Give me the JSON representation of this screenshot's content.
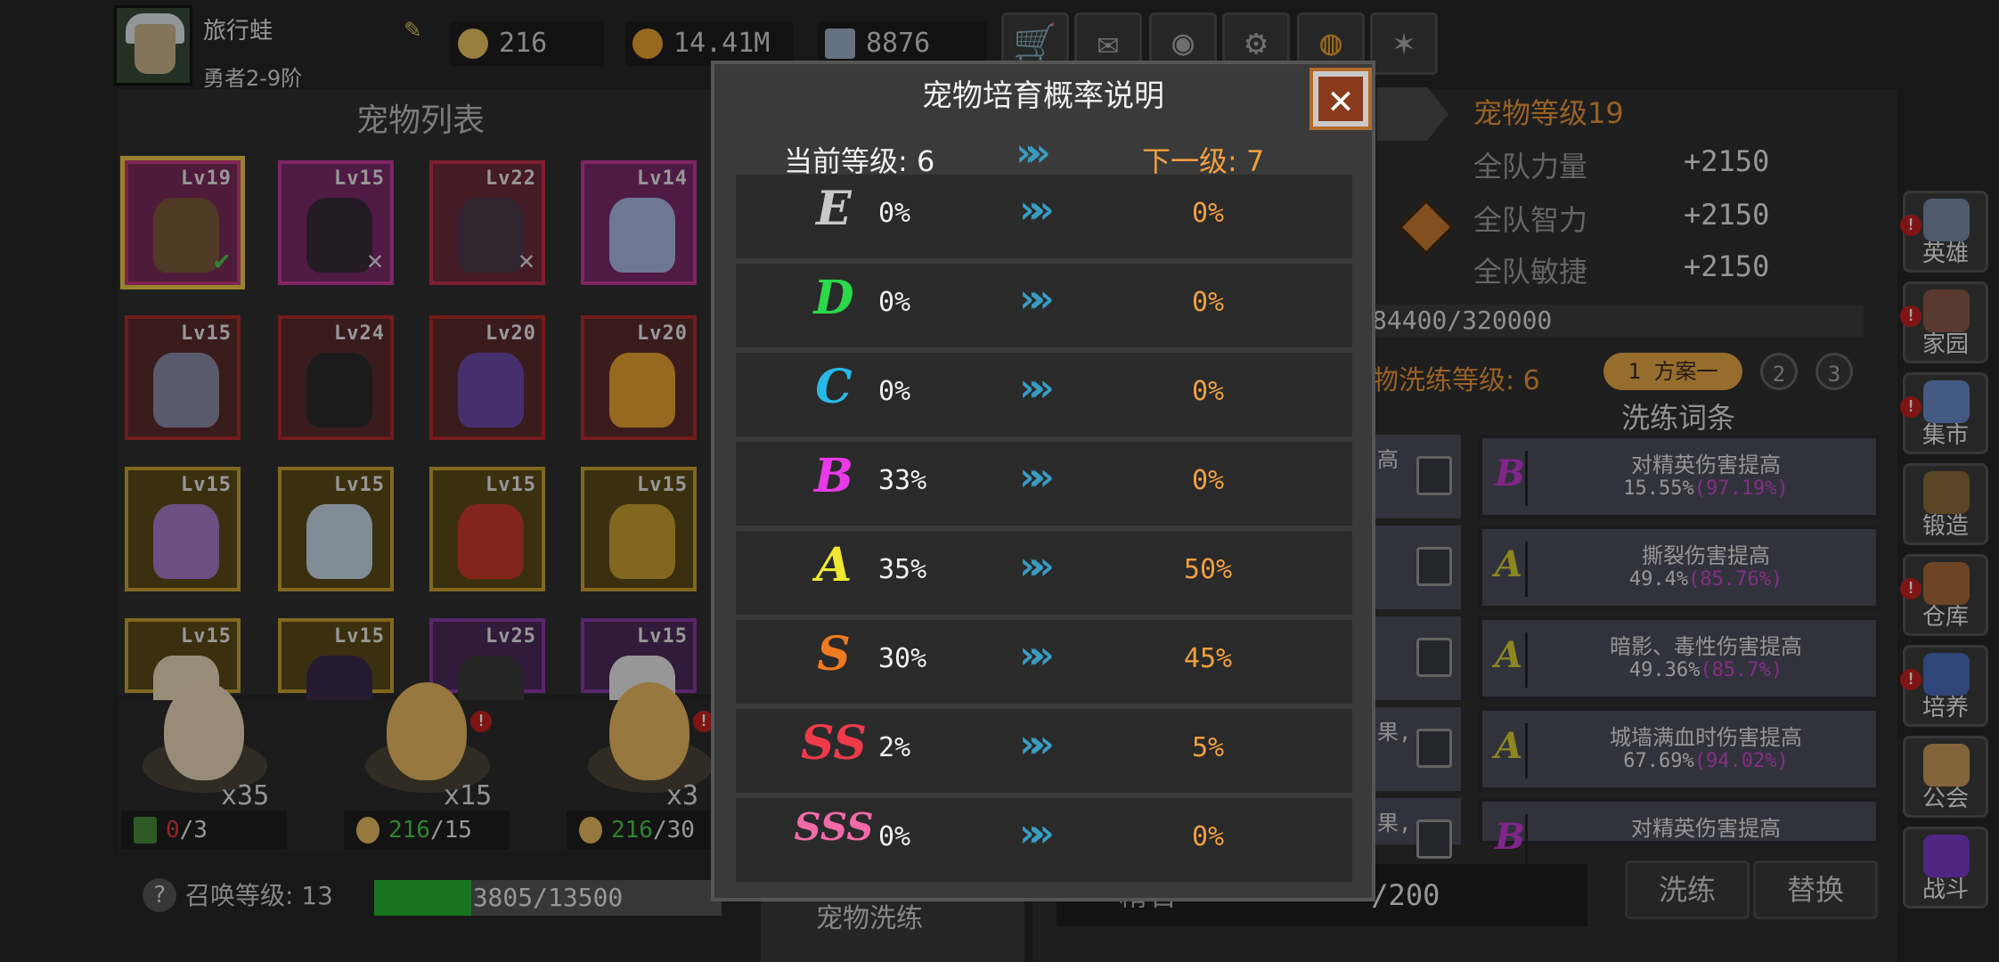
{
  "player": {
    "name": "旅行蛙",
    "rank": "勇者2-9阶"
  },
  "resources": [
    {
      "icon": "egg-icon",
      "value": "216",
      "color": "#e8c060"
    },
    {
      "icon": "gold-coin-icon",
      "value": "14.41M",
      "color": "#e8a030"
    },
    {
      "icon": "gem-icon",
      "value": "8876",
      "color": "#9ab0c8"
    }
  ],
  "top_buttons": [
    "cart-icon",
    "mail-icon",
    "gamepad-icon",
    "gear-icon",
    "color-wheel-icon",
    "firework-icon"
  ],
  "pet_list": {
    "title": "宠物列表",
    "pets": [
      {
        "level": "Lv19",
        "border": "#c43a7a",
        "bg": "#7a2a5a",
        "sprite": "#7a5a3a",
        "mark": "✔"
      },
      {
        "level": "Lv15",
        "border": "#c43a9a",
        "bg": "#7a2a6a",
        "sprite": "#3a2a3a",
        "mark": "✕"
      },
      {
        "level": "Lv22",
        "border": "#c4304a",
        "bg": "#6a2a3a",
        "sprite": "#4a3a4a",
        "mark": "✕"
      },
      {
        "level": "Lv14",
        "border": "#c43a9a",
        "bg": "#7a2a6a",
        "sprite": "#aab8e0",
        "mark": ""
      },
      {
        "level": "Lv15",
        "border": "#b02a2a",
        "bg": "#5a2a2a",
        "sprite": "#8a8aa8",
        "mark": ""
      },
      {
        "level": "Lv24",
        "border": "#b02a2a",
        "bg": "#5a2a2a",
        "sprite": "#2a2a2a",
        "mark": ""
      },
      {
        "level": "Lv20",
        "border": "#b02a2a",
        "bg": "#5a2a2a",
        "sprite": "#6a4aa8",
        "mark": ""
      },
      {
        "level": "Lv20",
        "border": "#b02a2a",
        "bg": "#5a2a2a",
        "sprite": "#e8a030",
        "mark": ""
      },
      {
        "level": "Lv15",
        "border": "#c8a030",
        "bg": "#5a4a1a",
        "sprite": "#a87ac8",
        "mark": ""
      },
      {
        "level": "Lv15",
        "border": "#c8a030",
        "bg": "#5a4a1a",
        "sprite": "#c8d8e8",
        "mark": ""
      },
      {
        "level": "Lv15",
        "border": "#c8a030",
        "bg": "#5a4a1a",
        "sprite": "#c83a2a",
        "mark": ""
      },
      {
        "level": "Lv15",
        "border": "#c8a030",
        "bg": "#5a4a1a",
        "sprite": "#c8a030",
        "mark": ""
      },
      {
        "level": "Lv15",
        "border": "#c8a030",
        "bg": "#5a4a1a",
        "sprite": "#e8d8b8",
        "mark": ""
      },
      {
        "level": "Lv15",
        "border": "#c8a030",
        "bg": "#5a4a1a",
        "sprite": "#3a2a4a",
        "mark": ""
      },
      {
        "level": "Lv25",
        "border": "#8a3aa8",
        "bg": "#4a2a5a",
        "sprite": "#3a3a3a",
        "mark": ""
      },
      {
        "level": "Lv15",
        "border": "#8a3aa8",
        "bg": "#4a2a5a",
        "sprite": "#e8e8e8",
        "mark": ""
      }
    ]
  },
  "eggs": [
    {
      "count": "x35",
      "cost_used": "0",
      "cost_total": "/3",
      "cost_color": "#e03a3a",
      "cost_icon": "video-ad-icon",
      "egg_color": "#ead8b8",
      "badge": false
    },
    {
      "count": "x15",
      "cost_used": "216",
      "cost_total": "/15",
      "cost_color": "#4ac84a",
      "cost_icon": "egg-icon",
      "egg_color": "#e8b860",
      "badge": true
    },
    {
      "count": "x3",
      "cost_used": "216",
      "cost_total": "/30",
      "cost_color": "#4ac84a",
      "cost_icon": "egg-icon",
      "egg_color": "#e8b860",
      "badge": true
    }
  ],
  "summon": {
    "label": "召唤等级: 13",
    "progress_text": "3805/13500",
    "progress": 0.28
  },
  "pet_detail": {
    "pet_level": "宠物等级19",
    "stats": [
      {
        "label": "全队力量",
        "value": "+2150"
      },
      {
        "label": "全队智力",
        "value": "+2150"
      },
      {
        "label": "全队敏捷",
        "value": "+2150"
      }
    ],
    "exp_text": "84400/320000",
    "wash_level": "物洗练等级: 6",
    "plans": [
      "1 方案一",
      "2",
      "3"
    ],
    "affix_title": "洗练词条",
    "affixes": [
      {
        "grade": "B",
        "grade_color": "#c83ad8",
        "name": "对精英伤害提高",
        "val": "15.55%",
        "max": "(97.19%)"
      },
      {
        "grade": "A",
        "grade_color": "#d8d030",
        "name": "撕裂伤害提高",
        "val": "49.4%",
        "max": "(85.76%)"
      },
      {
        "grade": "A",
        "grade_color": "#d8d030",
        "name": "暗影、毒性伤害提高",
        "val": "49.36%",
        "max": "(85.7%)"
      },
      {
        "grade": "A",
        "grade_color": "#d8d030",
        "name": "城墙满血时伤害提高",
        "val": "67.69%",
        "max": "(94.02%)"
      },
      {
        "grade": "B",
        "grade_color": "#c83ad8",
        "name": "对精英伤害提高",
        "val": "",
        "max": ""
      }
    ],
    "partial_left_text": [
      "高",
      "",
      "",
      "果,",
      "果,"
    ],
    "wash_button": "洗练",
    "replace_button": "替换",
    "stone_count": "/200",
    "stone_label": "精石"
  },
  "pet_wash_tab": "宠物洗练",
  "side_nav": [
    {
      "label": "英雄",
      "icon": "hero-helmet-icon",
      "color": "#7a8aa8",
      "badge": true
    },
    {
      "label": "家园",
      "icon": "home-castle-icon",
      "color": "#8a5a4a",
      "badge": true
    },
    {
      "label": "集市",
      "icon": "market-stall-icon",
      "color": "#6a8ac8",
      "badge": true
    },
    {
      "label": "锻造",
      "icon": "anvil-hammer-icon",
      "color": "#8a6a3a",
      "badge": false
    },
    {
      "label": "仓库",
      "icon": "warehouse-chest-icon",
      "color": "#a86a3a",
      "badge": true
    },
    {
      "label": "培养",
      "icon": "trophy-cup-icon",
      "color": "#4a6ab8",
      "badge": true
    },
    {
      "label": "公会",
      "icon": "guild-lion-icon",
      "color": "#c89a5a",
      "badge": false
    },
    {
      "label": "战斗",
      "icon": "battle-portal-icon",
      "color": "#7a3ac8",
      "badge": false
    }
  ],
  "dialog": {
    "title": "宠物培育概率说明",
    "current_label": "当前等级: 6",
    "next_label": "下一级: 7",
    "rows": [
      {
        "grade": "E",
        "color": "#c8c8c8",
        "current": "0%",
        "next": "0%"
      },
      {
        "grade": "D",
        "color": "#2ad84a",
        "current": "0%",
        "next": "0%"
      },
      {
        "grade": "C",
        "color": "#2ab8e8",
        "current": "0%",
        "next": "0%"
      },
      {
        "grade": "B",
        "color": "#e83ae8",
        "current": "33%",
        "next": "0%"
      },
      {
        "grade": "A",
        "color": "#f0e830",
        "current": "35%",
        "next": "50%"
      },
      {
        "grade": "S",
        "color": "#f07a20",
        "current": "30%",
        "next": "45%"
      },
      {
        "grade": "SS",
        "color": "#f03a4a",
        "current": "2%",
        "next": "5%"
      },
      {
        "grade": "SSS",
        "color": "#f06aa8",
        "current": "0%",
        "next": "0%"
      }
    ]
  }
}
